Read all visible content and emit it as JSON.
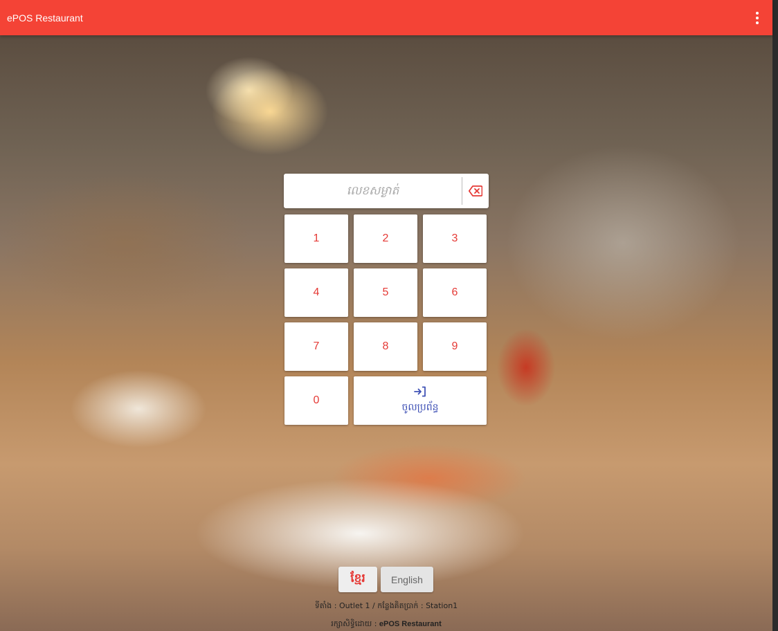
{
  "app": {
    "title": "ePOS Restaurant",
    "menu_icon": "more-vertical-icon",
    "accent_color": "#f44336"
  },
  "login": {
    "pin_placeholder": "លេខសម្ងាត់",
    "clear_icon": "backspace-icon",
    "keys": [
      "1",
      "2",
      "3",
      "4",
      "5",
      "6",
      "7",
      "8",
      "9",
      "0"
    ],
    "login_icon": "login-icon",
    "login_label": "ចូលប្រព័ន្ធ"
  },
  "language": {
    "khmer_label": "ខ្មែរ",
    "english_label": "English"
  },
  "footer": {
    "location_prefix": "ទីតាំង : ",
    "outlet": "Outlet 1",
    "separator": " / ",
    "station_prefix": "កន្លែងគិតប្រាក់ : ",
    "station": "Station1",
    "powered_prefix": "រក្សាសិទ្ធិដោយ : ",
    "powered_by": "ePOS Restaurant"
  }
}
